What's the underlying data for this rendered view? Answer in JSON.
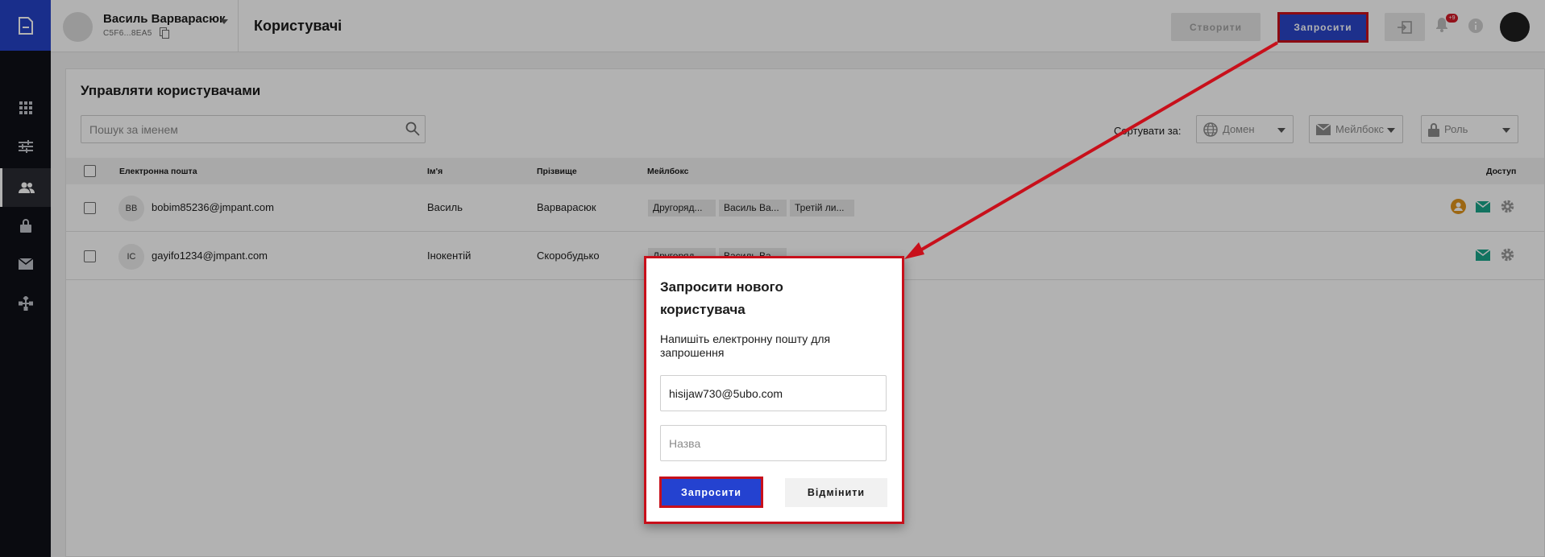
{
  "account": {
    "name": "Василь Варварасюк",
    "id": "C5F6...8EA5"
  },
  "header": {
    "title": "Користувачі",
    "create_label": "Створити",
    "invite_label": "Запросити",
    "notification_count": "+9"
  },
  "nav": {
    "items": [
      "grid-icon",
      "sliders-icon",
      "users-icon",
      "lock-icon",
      "mail-icon",
      "network-icon"
    ],
    "active": "users-icon"
  },
  "manage": {
    "title": "Управляти користувачами",
    "search_placeholder": "Пошук за іменем",
    "sort_label": "Сортувати за:",
    "sort_options": [
      "Домен",
      "Мейлбокс",
      "Роль"
    ]
  },
  "table": {
    "headers": [
      "Електронна пошта",
      "Ім'я",
      "Прізвище",
      "Мейлбокс",
      "Доступ"
    ],
    "rows": [
      {
        "initials": "BB",
        "email": "bobim85236@jmpant.com",
        "first": "Василь",
        "last": "Варварасюк",
        "mailboxes": [
          "Другоряд...",
          "Василь Ва...",
          "Третій ли..."
        ]
      },
      {
        "initials": "IC",
        "email": "gayifo1234@jmpant.com",
        "first": "Інокентій",
        "last": "Скоробудько",
        "mailboxes": [
          "Другоряд...",
          "Василь Ва..."
        ]
      }
    ]
  },
  "dialog": {
    "title": "Запросити нового користувача",
    "text": "Напишіть електронну пошту для запрошення",
    "email_value": "hisijaw730@5ubo.com",
    "name_placeholder": "Назва",
    "submit_label": "Запросити",
    "cancel_label": "Відмінити"
  },
  "colors": {
    "brand": "#2442c8",
    "highlight": "#c8101b",
    "rail": "#0f1117"
  }
}
